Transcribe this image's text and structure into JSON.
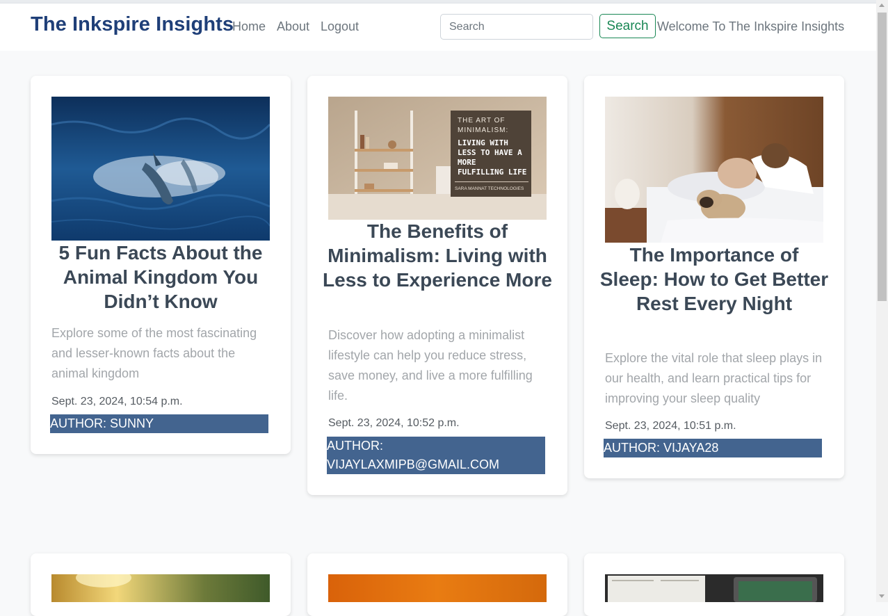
{
  "navbar": {
    "brand": "The Inkspire Insights",
    "links": [
      "Home",
      "About",
      "Logout"
    ],
    "search_placeholder": "Search",
    "search_button": "Search",
    "welcome": "Welcome To The Inkspire Insights"
  },
  "posts": [
    {
      "title": "5 Fun Facts About the Animal Kingdom You Didn’t Know",
      "excerpt": "Explore some of the most fascinating and lesser-known facts about the animal kingdom",
      "date": "Sept. 23, 2024, 10:54 p.m.",
      "author": "AUTHOR: SUNNY"
    },
    {
      "title": "The Benefits of Minimalism: Living with Less to Experience More",
      "excerpt": "Discover how adopting a minimalist lifestyle can help you reduce stress, save money, and live a more fulfilling life.",
      "date": "Sept. 23, 2024, 10:52 p.m.",
      "author": "AUTHOR: VIJAYLAXMIPB@GMAIL.COM",
      "image_text": {
        "line1": "THE ART OF",
        "line2": "MINIMALISM:",
        "line3": "LIVING WITH",
        "line4": "LESS TO HAVE A",
        "line5": "MORE",
        "line6": "FULFILLING LIFE",
        "credit": "SARA MANNAT TECHNOLOGIES"
      }
    },
    {
      "title": "The Importance of Sleep: How to Get Better Rest Every Night",
      "excerpt": "Explore the vital role that sleep plays in our health, and learn practical tips for improving your sleep quality",
      "date": "Sept. 23, 2024, 10:51 p.m.",
      "author": "AUTHOR: VIJAYA28"
    }
  ],
  "colors": {
    "brand": "#1f3f78",
    "author_bar": "#43648f",
    "search_button": "#198754"
  }
}
